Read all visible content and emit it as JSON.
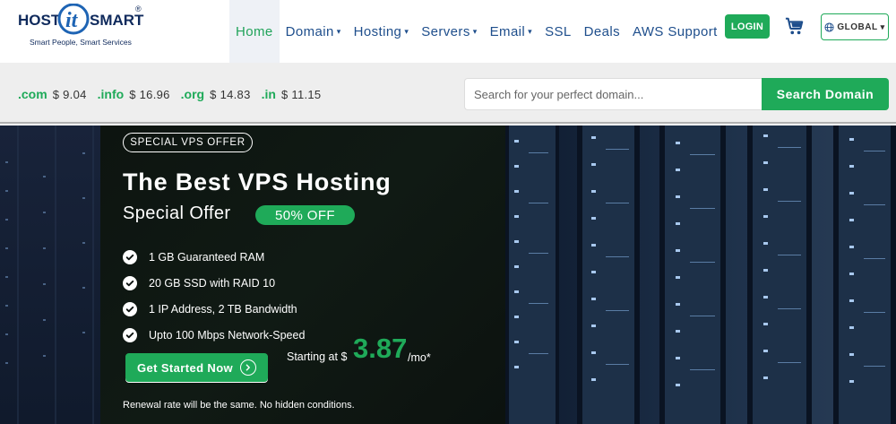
{
  "brand": {
    "name_left": "HOST",
    "name_mid": "it",
    "name_right": "SMART",
    "registered": "®",
    "tagline": "Smart People, Smart Services"
  },
  "nav": {
    "items": [
      {
        "label": "Home",
        "has_caret": false,
        "active": true
      },
      {
        "label": "Domain",
        "has_caret": true
      },
      {
        "label": "Hosting",
        "has_caret": true
      },
      {
        "label": "Servers",
        "has_caret": true
      },
      {
        "label": "Email",
        "has_caret": true
      },
      {
        "label": "SSL",
        "has_caret": false
      },
      {
        "label": "Deals",
        "has_caret": false
      },
      {
        "label": "AWS Support",
        "has_caret": false
      }
    ],
    "login_label": "LOGIN",
    "global_label": "GLOBAL",
    "caret_glyph": "▾"
  },
  "domain_bar": {
    "prices": [
      {
        "tld": ".com",
        "price": "$ 9.04"
      },
      {
        "tld": ".info",
        "price": "$ 16.96"
      },
      {
        "tld": ".org",
        "price": "$ 14.83"
      },
      {
        "tld": ".in",
        "price": "$ 11.15"
      }
    ],
    "search_placeholder": "Search for your perfect domain...",
    "search_button": "Search Domain"
  },
  "hero": {
    "badge": "SPECIAL VPS OFFER",
    "title": "The Best VPS Hosting",
    "subtitle": "Special Offer",
    "discount": "50% OFF",
    "features": [
      "1 GB Guaranteed RAM",
      "20 GB SSD with RAID 10",
      "1 IP Address, 2 TB Bandwidth",
      "Upto 100 Mbps Network-Speed"
    ],
    "cta_label": "Get Started Now",
    "starting_label": "Starting at $",
    "price": "3.87",
    "price_unit": "/mo*",
    "renewal_note": "Renewal rate will be the same. No hidden conditions."
  },
  "colors": {
    "brand_green": "#1faa59",
    "nav_blue": "#1e4e8c",
    "logo_navy": "#0f2a5c"
  },
  "icons": [
    "cart-icon",
    "globe-icon",
    "check-icon",
    "arrow-right-icon",
    "chevron-down-icon"
  ]
}
